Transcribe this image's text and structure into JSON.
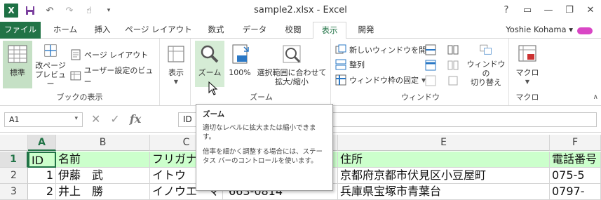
{
  "window": {
    "title": "sample2.xlsx - Excel",
    "help": "?",
    "controls": [
      "▭",
      "—",
      "❐",
      "✕"
    ]
  },
  "tabs": [
    {
      "label": "ファイル"
    },
    {
      "label": "ホーム"
    },
    {
      "label": "挿入"
    },
    {
      "label": "ページ レイアウト"
    },
    {
      "label": "数式"
    },
    {
      "label": "データ"
    },
    {
      "label": "校閲"
    },
    {
      "label": "表示"
    },
    {
      "label": "開発"
    }
  ],
  "active_tab": "表示",
  "user": {
    "name": "Yoshie Kohama ▾"
  },
  "ribbon": {
    "workbook_views": {
      "label": "ブックの表示",
      "normal": "標準",
      "page_break_line1": "改ページ",
      "page_break_line2": "プレビュー",
      "page_layout": "ページ レイアウト",
      "custom_views": "ユーザー設定のビュー"
    },
    "show": {
      "label": "表示"
    },
    "zoom": {
      "label": "ズーム",
      "zoom": "ズーム",
      "hundred": "100%",
      "zoom_sel_line1": "選択範囲に合わせて",
      "zoom_sel_line2": "拡大/縮小"
    },
    "window": {
      "label": "ウィンドウ",
      "new_window": "新しいウィンドウを開く",
      "arrange": "整列",
      "freeze": "ウィンドウ枠の固定",
      "switch_line1": "ウィンドウの",
      "switch_line2": "切り替え"
    },
    "macros": {
      "label": "マクロ",
      "macros": "マクロ"
    }
  },
  "formula_bar": {
    "name_box": "A1",
    "name_box_caret": "▾",
    "cancel": "✕",
    "enter": "✓",
    "fx": "fx",
    "content": "ID"
  },
  "grid": {
    "columns": [
      "A",
      "B",
      "C",
      "D",
      "E",
      "F"
    ],
    "rows": [
      {
        "num": "1",
        "cells": [
          "ID",
          "名前",
          "フリガナ",
          "",
          "住所",
          "電話番号"
        ]
      },
      {
        "num": "2",
        "cells": [
          "1",
          "伊藤　武",
          "イトウ　",
          "",
          "京都府京都市伏見区小豆屋町",
          "075-5"
        ]
      },
      {
        "num": "3",
        "cells": [
          "2",
          "井上　勝",
          "イノウエ　マサル",
          "663-0814",
          "兵庫県宝塚市青葉台",
          "0797-"
        ]
      }
    ]
  },
  "tooltip": {
    "title": "ズーム",
    "line1": "適切なレベルに拡大または縮小できます。",
    "line2": "倍率を細かく調整する場合には、ステータス バーのコントロールを使います。"
  }
}
